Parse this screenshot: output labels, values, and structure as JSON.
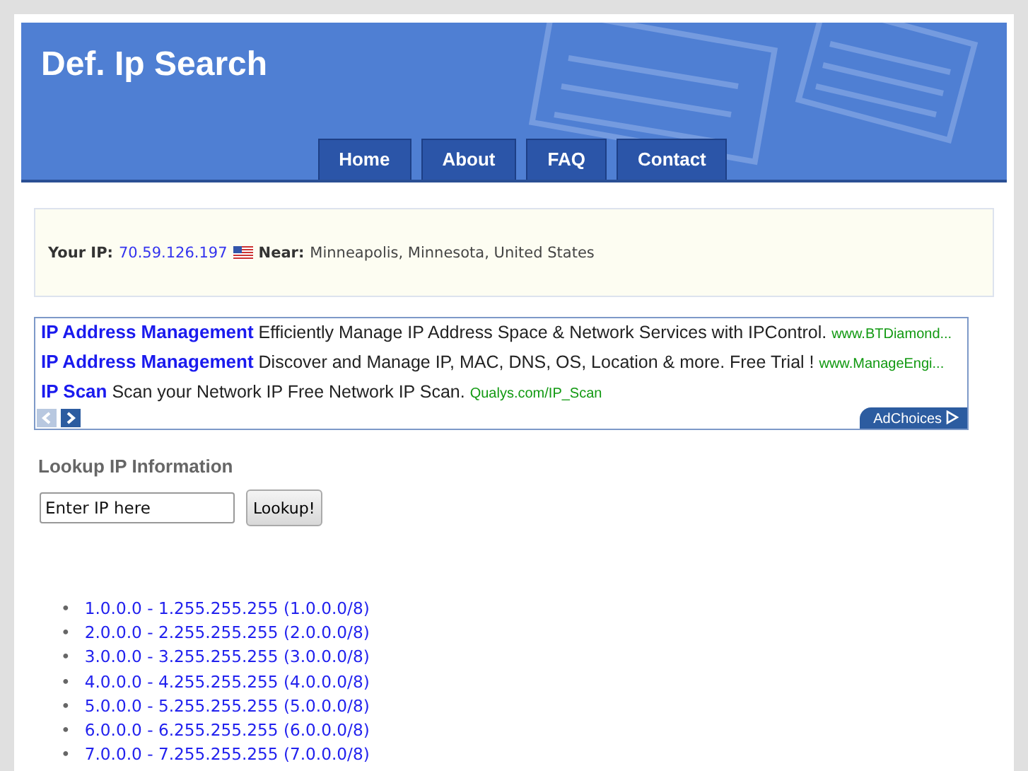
{
  "header": {
    "title": "Def. Ip Search"
  },
  "nav": [
    {
      "label": "Home"
    },
    {
      "label": "About"
    },
    {
      "label": "FAQ"
    },
    {
      "label": "Contact"
    }
  ],
  "ip_info": {
    "ip_label": "Your IP:",
    "ip": "70.59.126.197",
    "near_label": "Near:",
    "location": "Minneapolis, Minnesota, United States"
  },
  "ads": [
    {
      "title": "IP Address Management",
      "text": "Efficiently Manage IP Address Space & Network Services with IPControl.",
      "url": "www.BTDiamond..."
    },
    {
      "title": "IP Address Management",
      "text": "Discover and Manage IP, MAC, DNS, OS, Location & more. Free Trial !",
      "url": "www.ManageEngi..."
    },
    {
      "title": "IP Scan",
      "text": "Scan your Network IP Free Network IP Scan.",
      "url": "Qualys.com/IP_Scan"
    }
  ],
  "ad_choices": "AdChoices",
  "lookup": {
    "heading": "Lookup IP Information",
    "placeholder": "Enter IP here",
    "button": "Lookup!"
  },
  "ranges": [
    {
      "bullet": "•",
      "label": "1.0.0.0 - 1.255.255.255 (1.0.0.0/8)"
    },
    {
      "bullet": "•",
      "label": "2.0.0.0 - 2.255.255.255 (2.0.0.0/8)"
    },
    {
      "bullet": "•",
      "label": "3.0.0.0 - 3.255.255.255 (3.0.0.0/8)"
    },
    {
      "bullet": "•",
      "label": "4.0.0.0 - 4.255.255.255 (4.0.0.0/8)"
    },
    {
      "bullet": "•",
      "label": "5.0.0.0 - 5.255.255.255 (5.0.0.0/8)"
    },
    {
      "bullet": "•",
      "label": "6.0.0.0 - 6.255.255.255 (6.0.0.0/8)"
    },
    {
      "bullet": "•",
      "label": "7.0.0.0 - 7.255.255.255 (7.0.0.0/8)"
    }
  ]
}
